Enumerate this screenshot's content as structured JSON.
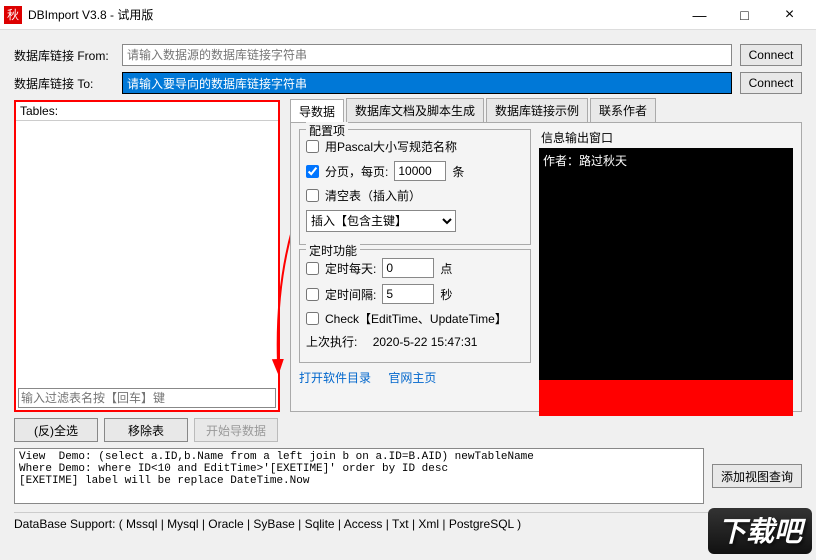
{
  "window": {
    "icon": "秋",
    "title": "DBImport V3.8 - 试用版",
    "min": "—",
    "max": "□",
    "close": "×"
  },
  "conn": {
    "fromLabel": "数据库链接 From:",
    "fromPlaceholder": "请输入数据源的数据库链接字符串",
    "toLabel": "数据库链接 To:",
    "toValue": "请输入要导向的数据库链接字符串",
    "connect": "Connect"
  },
  "tables": {
    "header": "Tables:",
    "filterPlaceholder": "输入过滤表名按【回车】键"
  },
  "tabs": {
    "t1": "导数据",
    "t2": "数据库文档及脚本生成",
    "t3": "数据库链接示例",
    "t4": "联系作者"
  },
  "cfg": {
    "group": "配置项",
    "pascal": "用Pascal大小写规范名称",
    "paging1": "分页，每页:",
    "pagingVal": "10000",
    "paging2": "条",
    "truncate": "清空表（插入前）",
    "insertMode": "插入【包含主键】"
  },
  "timer": {
    "group": "定时功能",
    "daily": "定时每天:",
    "dailyVal": "0",
    "dailyUnit": "点",
    "interval": "定时间隔:",
    "intervalVal": "5",
    "intervalUnit": "秒",
    "check": "Check【EditTime、UpdateTime】",
    "lastLabel": "上次执行:",
    "lastVal": "2020-5-22 15:47:31"
  },
  "links": {
    "dir": "打开软件目录",
    "web": "官网主页"
  },
  "out": {
    "label": "信息输出窗口",
    "line1": "作者：路过秋天"
  },
  "btns": {
    "selAll": "(反)全选",
    "remove": "移除表",
    "start": "开始导数据",
    "addview": "添加视图查询"
  },
  "demo": "View  Demo: (select a.ID,b.Name from a left join b on a.ID=B.AID) newTableName\nWhere Demo: where ID<10 and EditTime>'[EXETIME]' order by ID desc\n[EXETIME] label will be replace DateTime.Now",
  "status": "DataBase Support:     ( Mssql | Mysql | Oracle | SyBase | Sqlite | Access | Txt | Xml | PostgreSQL )",
  "watermark": "下载吧"
}
